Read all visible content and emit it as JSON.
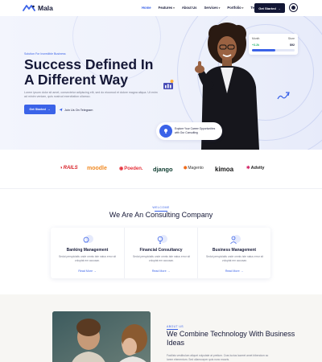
{
  "header": {
    "logo_text": "Mala",
    "menu": [
      {
        "label": "Home",
        "active": true
      },
      {
        "label": "Features"
      },
      {
        "label": "About Us"
      },
      {
        "label": "Services"
      },
      {
        "label": "Portfolio"
      },
      {
        "label": "Team"
      },
      {
        "label": "Blog"
      }
    ],
    "cta_label": "Get Started",
    "cta_icon": "arrow-right-icon",
    "theme_icon": "moon-icon"
  },
  "hero": {
    "subtitle": "Solution For Incredible Business",
    "title": "Success Defined In A Different Way",
    "description": "Lorem ipsum dolor sit amet, consectetur adipiscing elit, sed do eiusmod et dolore magna aliqua. Ut enim ad minim veniam, quis nostrud exercitation ullamco.",
    "primary_button": "Get Started",
    "secondary_link": "Join Us On Telegram",
    "stat_card": {
      "label_left": "Month",
      "label_right": "Store",
      "value_left": "+3.2k",
      "value_right": "$92",
      "progress": 0.55
    },
    "explore_text": "Explore Your Career Opportunities with Our Consulting"
  },
  "brands": [
    {
      "name": "RAILS",
      "color": "#d8232a"
    },
    {
      "name": "moodle",
      "color": "#f08a24"
    },
    {
      "name": "Poeden.",
      "color": "#e6333c"
    },
    {
      "name": "django",
      "color": "#0c3b2e"
    },
    {
      "name": "Magento",
      "color": "#ef6c1b"
    },
    {
      "name": "kimoa",
      "color": "#141414"
    },
    {
      "name": "Advity",
      "color": "#d42a6a"
    }
  ],
  "services": {
    "eyebrow": "WELCOME",
    "title": "We Are An Consulting Company",
    "cards": [
      {
        "title": "Banking Management",
        "description": "Sedut perspiciatis unde omnis iste natus error sit voluptat em accusan.",
        "link": "Read More",
        "icon": "money-hand-icon"
      },
      {
        "title": "Financial Consultancy",
        "description": "Sedut perspiciatis unde omnis iste natus error sit voluptat em accusan.",
        "link": "Read More",
        "icon": "lightbulb-icon"
      },
      {
        "title": "Business Management",
        "description": "Sedut perspiciatis unde omnis iste natus error sit voluptat em accusan.",
        "link": "Read More",
        "icon": "user-icon"
      }
    ]
  },
  "about": {
    "eyebrow": "ABOUT US",
    "title": "We Combine Technology With Business Ideas",
    "description": "Facilisis vestibulum aliquet vulputate at pretium. Cras luctus laoreet amet bibendum ac lorem elementum. Sed ullamcorper quis nunc mauris."
  },
  "colors": {
    "accent": "#3b63e8",
    "dark": "#121635"
  }
}
